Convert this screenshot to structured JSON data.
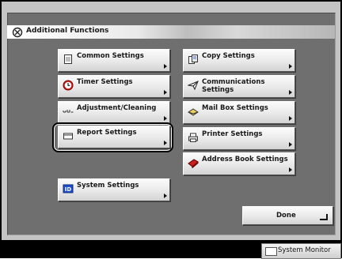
{
  "header": {
    "title": "Additional Functions",
    "icon": "additional-functions-icon"
  },
  "buttons": {
    "common_settings": {
      "label": "Common Settings",
      "icon": "document-icon"
    },
    "copy_settings": {
      "label": "Copy Settings",
      "icon": "copy-icon"
    },
    "timer_settings": {
      "label": "Timer Settings",
      "icon": "clock-icon"
    },
    "communications_settings": {
      "label_line1": "Communications",
      "label_line2": "Settings",
      "icon": "paper-plane-icon"
    },
    "adjustment_cleaning": {
      "label": "Adjustment/Cleaning",
      "icon": "adjustment-icon"
    },
    "mail_box_settings": {
      "label": "Mail Box Settings",
      "icon": "mailbox-icon"
    },
    "report_settings": {
      "label": "Report Settings",
      "icon": "report-icon",
      "selected": true
    },
    "printer_settings": {
      "label": "Printer Settings",
      "icon": "printer-icon"
    },
    "address_book_settings": {
      "label": "Address Book Settings",
      "icon": "address-book-icon"
    },
    "system_settings": {
      "label": "System Settings",
      "icon": "id-icon"
    },
    "done": {
      "label": "Done",
      "icon": "return-icon"
    }
  },
  "status_bar": {
    "system_monitor_label": "System Monitor",
    "icon": "monitor-icon"
  },
  "colors": {
    "panel": "#6f6f6f",
    "frame": "#c4c4c4",
    "button_face": "#e9e9e9",
    "accent_red": "#cc1f1f",
    "accent_blue": "#1f4fcc"
  }
}
